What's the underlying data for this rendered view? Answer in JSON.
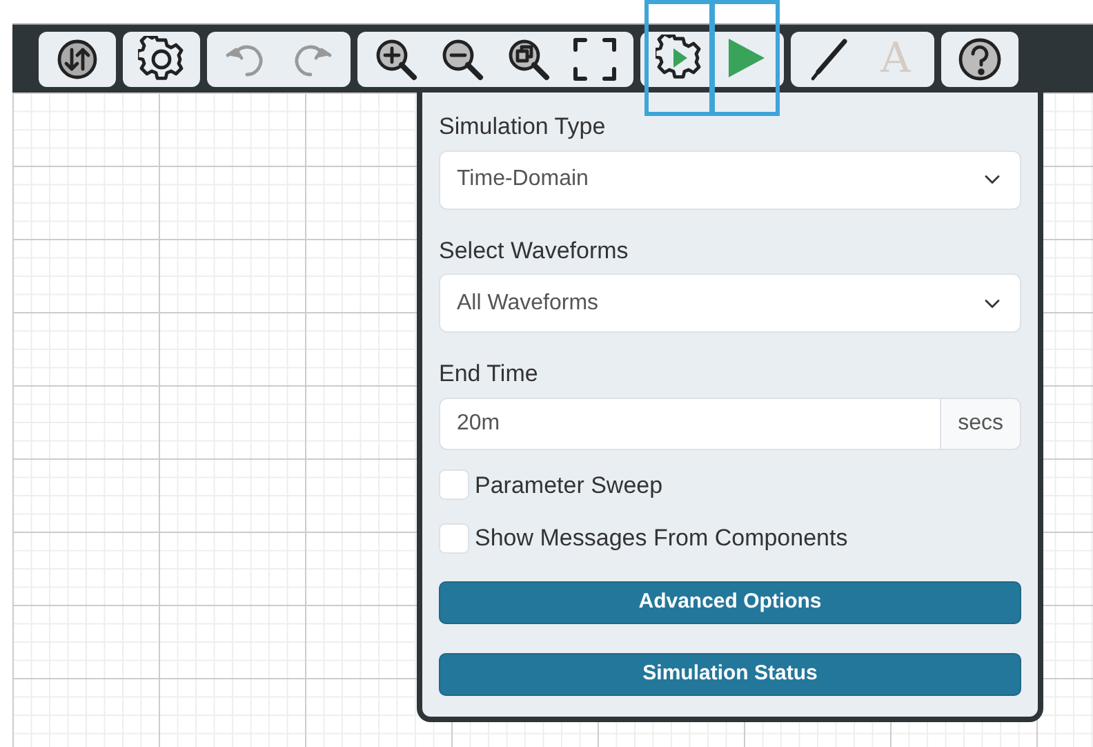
{
  "toolbar": [
    {
      "buttons": [
        {
          "kind": "swap",
          "disabled": false,
          "highlighted": false
        }
      ]
    },
    {
      "buttons": [
        {
          "kind": "gear",
          "disabled": false,
          "highlighted": false
        }
      ]
    },
    {
      "buttons": [
        {
          "kind": "undo",
          "disabled": true,
          "highlighted": false
        },
        {
          "kind": "redo",
          "disabled": true,
          "highlighted": false
        }
      ]
    },
    {
      "buttons": [
        {
          "kind": "zoom-in",
          "disabled": false,
          "highlighted": false
        },
        {
          "kind": "zoom-out",
          "disabled": false,
          "highlighted": false
        },
        {
          "kind": "zoom-fit",
          "disabled": false,
          "highlighted": false
        },
        {
          "kind": "fullscreen",
          "disabled": false,
          "highlighted": false
        }
      ]
    },
    {
      "buttons": [
        {
          "kind": "sim-settings",
          "disabled": false,
          "highlighted": true
        },
        {
          "kind": "run",
          "disabled": false,
          "highlighted": true
        }
      ]
    },
    {
      "buttons": [
        {
          "kind": "pen",
          "disabled": false,
          "highlighted": false
        },
        {
          "kind": "text",
          "label": "A",
          "disabled": true,
          "highlighted": false
        }
      ]
    },
    {
      "buttons": [
        {
          "kind": "help",
          "disabled": false,
          "highlighted": false
        }
      ]
    }
  ],
  "panel": {
    "fields": [
      {
        "kind": "select",
        "label": "Simulation Type",
        "value": "Time-Domain"
      },
      {
        "kind": "select",
        "label": "Select Waveforms",
        "value": "All Waveforms"
      },
      {
        "kind": "input",
        "label": "End Time",
        "value": "20m",
        "unit": "secs"
      }
    ],
    "checkboxes": [
      {
        "label": "Parameter Sweep",
        "checked": false
      },
      {
        "label": "Show Messages From Components",
        "checked": false
      }
    ],
    "buttons": [
      "Advanced Options",
      "Simulation Status"
    ]
  }
}
